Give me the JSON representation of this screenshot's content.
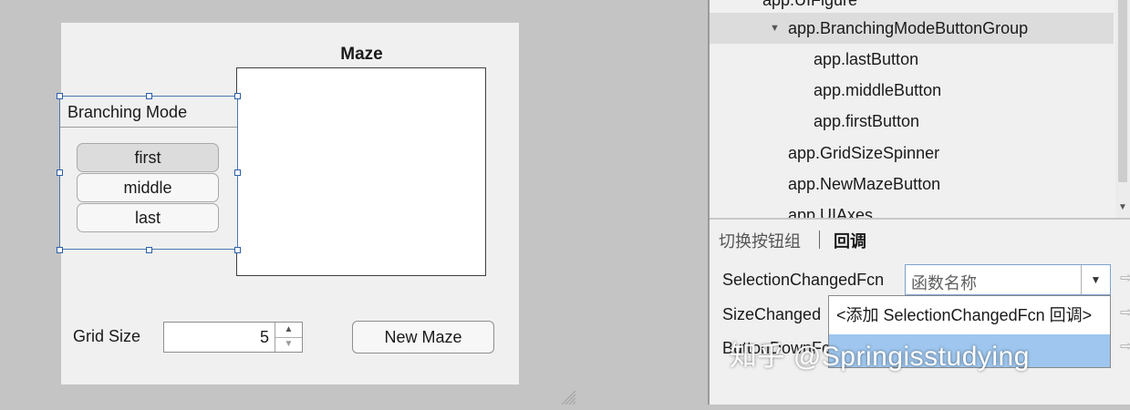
{
  "canvas": {
    "axes_title": "Maze",
    "button_group_title": "Branching Mode",
    "toggle_buttons": [
      "first",
      "middle",
      "last"
    ],
    "selected_toggle": "first",
    "grid_size_label": "Grid Size",
    "grid_size_value": "5",
    "new_maze_label": "New Maze"
  },
  "component_browser": {
    "items": [
      "app.UIFigure",
      "app.BranchingModeButtonGroup",
      "app.lastButton",
      "app.middleButton",
      "app.firstButton",
      "app.GridSizeSpinner",
      "app.NewMazeButton",
      "app.UIAxes"
    ],
    "selected_item": "app.BranchingModeButtonGroup"
  },
  "inspector": {
    "tabs": [
      "切换按钮组",
      "回调"
    ],
    "active_tab": "回调",
    "properties": [
      "SelectionChangedFcn",
      "SizeChanged",
      "ButtonDownFcn"
    ],
    "callback_placeholder": "函数名称",
    "dropdown_options": [
      "<添加 SelectionChangedFcn 回调>",
      ""
    ]
  },
  "watermark": "知乎 @Springisstudying",
  "colors": {
    "selection_border": "#2d5fa8",
    "dropdown_highlight": "#9ec6ee",
    "tree_selected": "#dcdcdc"
  }
}
